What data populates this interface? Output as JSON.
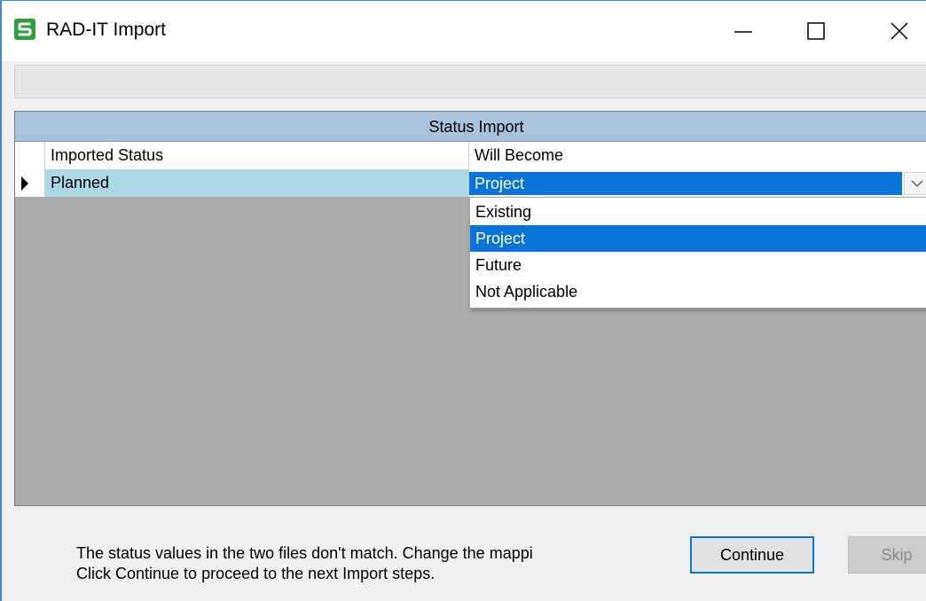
{
  "window": {
    "title": "RAD-IT Import",
    "controls": {
      "minimize": "minimize-icon",
      "maximize": "maximize-icon",
      "close": "close-icon"
    },
    "app_icon": "app-s-icon"
  },
  "grid": {
    "title": "Status Import",
    "columns": [
      "Imported Status",
      "Will Become"
    ],
    "rows": [
      {
        "imported_status": "Planned",
        "will_become": "Project"
      }
    ]
  },
  "dropdown": {
    "selected": "Project",
    "options": [
      "Existing",
      "Project",
      "Future",
      "Not Applicable"
    ]
  },
  "message": {
    "line1": "The status values in the two files don't match. Change the mappi",
    "line2": "Click Continue to proceed to the next Import steps."
  },
  "buttons": {
    "continue": "Continue",
    "skip": "Skip"
  },
  "colors": {
    "accent": "#0a74da",
    "header": "#a9c3dd",
    "row_highlight": "#add8e6"
  }
}
